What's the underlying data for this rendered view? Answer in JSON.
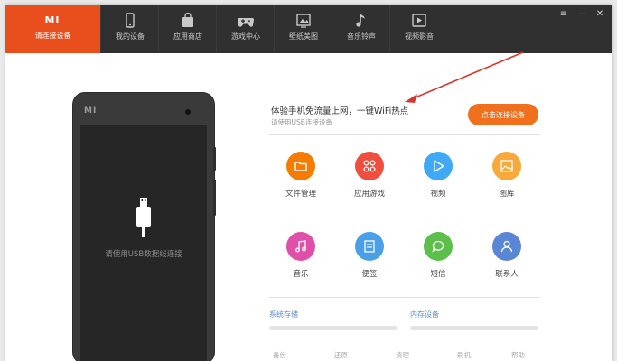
{
  "header": {
    "brand_logo": "MI",
    "brand_label": "请连接设备",
    "tabs": [
      {
        "label": "我的设备",
        "icon": "phone-icon"
      },
      {
        "label": "应用商店",
        "icon": "bag-icon"
      },
      {
        "label": "游戏中心",
        "icon": "gamepad-icon"
      },
      {
        "label": "壁纸美图",
        "icon": "picture-icon"
      },
      {
        "label": "音乐铃声",
        "icon": "music-note-icon"
      },
      {
        "label": "视频影音",
        "icon": "play-icon"
      }
    ],
    "controls": {
      "menu": "≡",
      "minimize": "—",
      "close": "✕"
    }
  },
  "phone": {
    "logo": "MI",
    "hint": "请使用USB数据线连接"
  },
  "main": {
    "headline": "体验手机免流量上网，一键WiFi热点",
    "subline": "请使用USB连接设备",
    "connect_button": "点击连接设备",
    "apps": [
      {
        "label": "文件管理",
        "color": "#f57c00",
        "icon": "folder-icon"
      },
      {
        "label": "应用游戏",
        "color": "#f04e3e",
        "icon": "grid-icon"
      },
      {
        "label": "视频",
        "color": "#3fa9f5",
        "icon": "play-icon"
      },
      {
        "label": "图库",
        "color": "#f7a93b",
        "icon": "image-icon"
      },
      {
        "label": "音乐",
        "color": "#e04fa8",
        "icon": "music-icon"
      },
      {
        "label": "便签",
        "color": "#4a9fe8",
        "icon": "note-icon"
      },
      {
        "label": "短信",
        "color": "#5cbf4a",
        "icon": "message-icon"
      },
      {
        "label": "联系人",
        "color": "#5a86d6",
        "icon": "contact-icon"
      }
    ],
    "storage": {
      "system_label": "系统存储",
      "internal_label": "内存设备"
    },
    "footer": [
      "备份",
      "还原",
      "清理",
      "刷机",
      "帮助"
    ]
  },
  "colors": {
    "brand": "#e84f1c",
    "topbar": "#303030",
    "accent": "#f0701e",
    "arrow": "#d9362b"
  }
}
